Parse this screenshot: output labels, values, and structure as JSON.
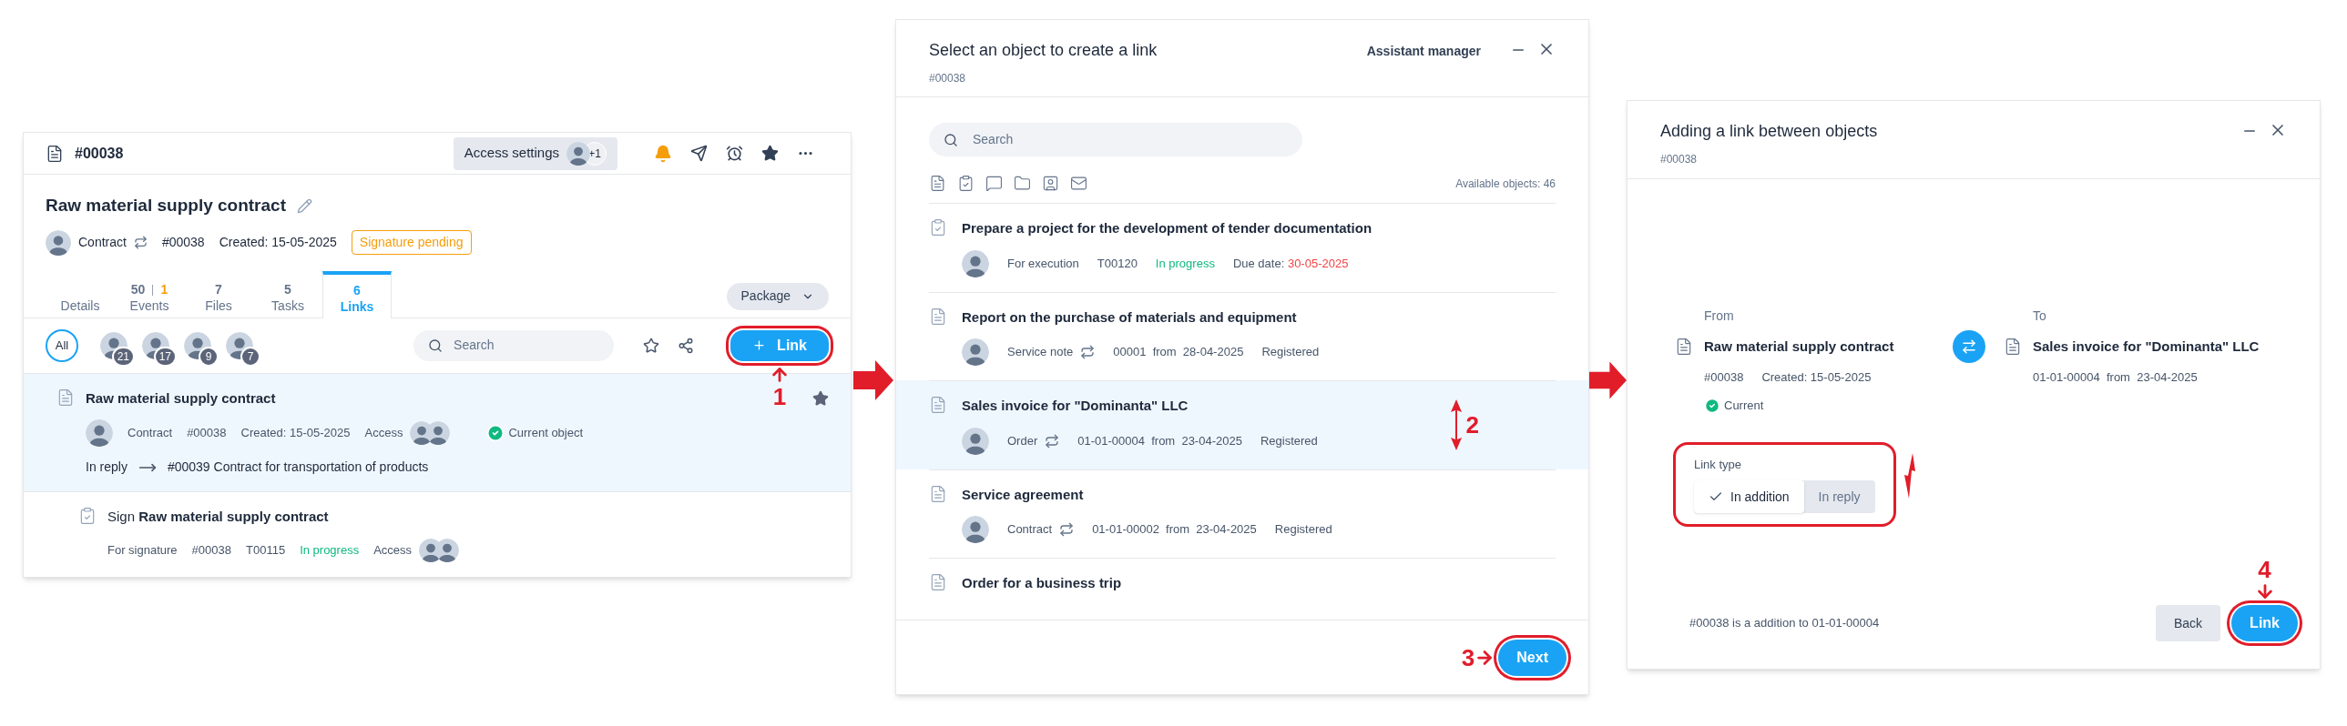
{
  "card": {
    "header": {
      "number": "#00038",
      "access_button": "Access settings",
      "access_extra": "+1"
    },
    "title": "Raw material supply contract",
    "meta": {
      "type": "Contract",
      "number": "#00038",
      "created": "Created: 15-05-2025",
      "status": "Signature pending"
    },
    "tabs": [
      {
        "label": "Details",
        "selected": false
      },
      {
        "count": "50",
        "extra": "1",
        "label": "Events",
        "selected": false
      },
      {
        "count": "7",
        "label": "Files",
        "selected": false
      },
      {
        "count": "5",
        "label": "Tasks",
        "selected": false
      },
      {
        "count": "6",
        "label": "Links",
        "selected": true
      }
    ],
    "package_button": "Package",
    "filter": {
      "all": "All",
      "selected": true,
      "people": [
        {
          "count": "21"
        },
        {
          "count": "17"
        },
        {
          "count": "9"
        },
        {
          "count": "7"
        }
      ]
    },
    "search": {
      "placeholder": "Search"
    },
    "link_button": {
      "label": "Link",
      "annotated": true,
      "step": "1"
    },
    "links": [
      {
        "kind": "document",
        "title": "Raw material supply contract",
        "selected": true,
        "starred": true,
        "meta": [
          {
            "kind": "avatar"
          },
          {
            "kind": "plain",
            "text": "Contract"
          },
          {
            "kind": "plain",
            "text": "#00038"
          },
          {
            "kind": "plain",
            "text": "Created: 15-05-2025"
          },
          {
            "kind": "access",
            "text": "Access"
          },
          {
            "kind": "current",
            "text": "Current object"
          }
        ],
        "reply": {
          "label": "In reply",
          "target": "#00039 Contract for transportation of products"
        }
      },
      {
        "kind": "task",
        "prefix": "Sign",
        "title": "Raw material supply contract",
        "selected": false,
        "starred": false,
        "meta": [
          {
            "kind": "plain",
            "text": "For signature"
          },
          {
            "kind": "plain",
            "text": "#00038"
          },
          {
            "kind": "plain",
            "text": "T00115"
          },
          {
            "kind": "green",
            "text": "In progress"
          },
          {
            "kind": "access",
            "text": "Access"
          }
        ]
      }
    ]
  },
  "picker": {
    "title": "Select an object to create a link",
    "subtitle": "#00038",
    "assistant": "Assistant manager",
    "search": {
      "placeholder": "Search"
    },
    "available": "Available objects: 46",
    "items": [
      {
        "kind": "task",
        "title": "Prepare a project for the development of tender documentation",
        "selected": false,
        "meta": [
          {
            "kind": "avatar"
          },
          {
            "kind": "plain",
            "text": "For execution"
          },
          {
            "kind": "plain",
            "text": "T00120"
          },
          {
            "kind": "green",
            "text": "In progress"
          },
          {
            "kind": "due",
            "label": "Due date:",
            "value": "30-05-2025"
          }
        ]
      },
      {
        "kind": "document",
        "title": "Report on the purchase of materials and equipment",
        "selected": false,
        "meta": [
          {
            "kind": "avatar"
          },
          {
            "kind": "cycle",
            "text": "Service note"
          },
          {
            "kind": "plain",
            "text": "00001  from  28-04-2025"
          },
          {
            "kind": "plain",
            "text": "Registered"
          }
        ]
      },
      {
        "kind": "document",
        "title": "Sales invoice for \"Dominanta\" LLC",
        "selected": true,
        "step": "2",
        "meta": [
          {
            "kind": "avatar"
          },
          {
            "kind": "cycle",
            "text": "Order"
          },
          {
            "kind": "plain",
            "text": "01-01-00004  from  23-04-2025"
          },
          {
            "kind": "plain",
            "text": "Registered"
          }
        ]
      },
      {
        "kind": "document",
        "title": "Service agreement",
        "selected": false,
        "meta": [
          {
            "kind": "avatar"
          },
          {
            "kind": "cycle",
            "text": "Contract"
          },
          {
            "kind": "plain",
            "text": "01-01-00002  from  23-04-2025"
          },
          {
            "kind": "plain",
            "text": "Registered"
          }
        ]
      },
      {
        "kind": "document",
        "title": "Order for a business trip",
        "selected": false
      }
    ],
    "next_button": {
      "label": "Next",
      "annotated": true,
      "step": "3"
    }
  },
  "link_dialog": {
    "title": "Adding a link between objects",
    "subtitle": "#00038",
    "from": {
      "label": "From",
      "title": "Raw material supply contract",
      "meta": [
        "#00038",
        "Created: 15-05-2025"
      ],
      "current": "Current"
    },
    "to": {
      "label": "To",
      "title": "Sales invoice for \"Dominanta\" LLC",
      "meta": [
        "01-01-00004  from  23-04-2025"
      ]
    },
    "link_type": {
      "label": "Link type",
      "annotated": true,
      "options": [
        {
          "label": "In addition",
          "selected": true
        },
        {
          "label": "In reply",
          "selected": false
        }
      ]
    },
    "summary": "#00038 is a addition to 01-01-00004",
    "back_button": "Back",
    "link_button": {
      "label": "Link",
      "annotated": true,
      "step": "4"
    }
  }
}
